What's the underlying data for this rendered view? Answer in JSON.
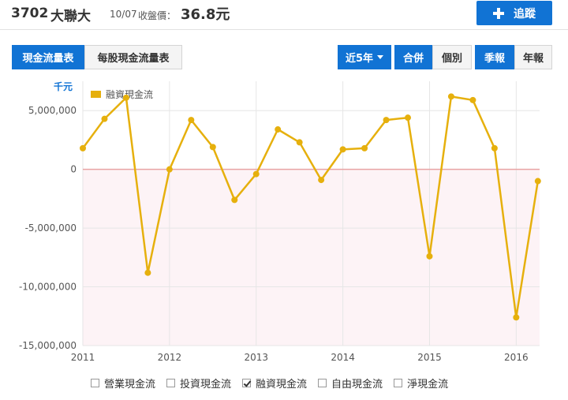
{
  "header": {
    "code": "3702",
    "name": "大聯大",
    "date": "10/07",
    "price_label": "收盤價：",
    "price": "36.8元",
    "follow_label": "追蹤"
  },
  "toolbar": {
    "cashflow_table": "現金流量表",
    "per_share_table": "每股現金流量表",
    "period": "近5年",
    "consolidated": "合併",
    "individual": "個別",
    "quarterly": "季報",
    "annual": "年報"
  },
  "colors": {
    "accent": "#1173d4",
    "series": "#e6b00d",
    "zero_line": "#e8a3a3",
    "negative_fill": "#fdf3f6"
  },
  "chart_data": {
    "type": "line",
    "ylabel": "千元",
    "ylim": [
      -15000000,
      7500000
    ],
    "y_ticks": [
      5000000,
      0,
      -5000000,
      -10000000,
      -15000000
    ],
    "y_tick_labels": [
      "5,000,000",
      "0",
      "-5,000,000",
      "-10,000,000",
      "-15,000,000"
    ],
    "x_ticks": [
      2011,
      2012,
      2013,
      2014,
      2015,
      2016
    ],
    "x_tick_labels": [
      "2011",
      "2012",
      "2013",
      "2014",
      "2015",
      "2016"
    ],
    "xlim": [
      2011,
      2016.27
    ],
    "legend": "top-left",
    "grid": true,
    "series": [
      {
        "name": "融資現金流",
        "x": [
          2011.0,
          2011.25,
          2011.5,
          2011.75,
          2012.0,
          2012.25,
          2012.5,
          2012.75,
          2013.0,
          2013.25,
          2013.5,
          2013.75,
          2014.0,
          2014.25,
          2014.5,
          2014.75,
          2015.0,
          2015.25,
          2015.5,
          2015.75,
          2016.0,
          2016.25
        ],
        "values": [
          1800000,
          4300000,
          6100000,
          -8800000,
          0,
          4200000,
          1900000,
          -2600000,
          -400000,
          3400000,
          2300000,
          -900000,
          1700000,
          1800000,
          4200000,
          4400000,
          -7400000,
          6200000,
          5900000,
          1800000,
          -12600000,
          -1000000
        ]
      }
    ]
  },
  "bottom_legend": [
    {
      "label": "營業現金流",
      "checked": false
    },
    {
      "label": "投資現金流",
      "checked": false
    },
    {
      "label": "融資現金流",
      "checked": true
    },
    {
      "label": "自由現金流",
      "checked": false
    },
    {
      "label": "淨現金流",
      "checked": false
    }
  ]
}
